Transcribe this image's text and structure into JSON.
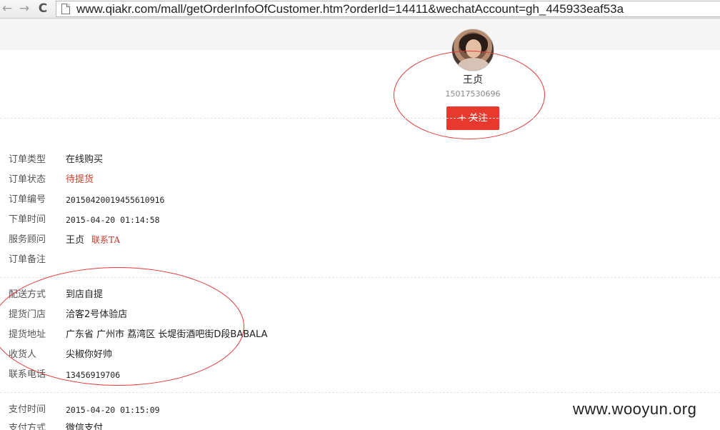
{
  "browser": {
    "back_icon": "←",
    "forward_icon": "→",
    "reload_icon": "C",
    "url": "www.qiakr.com/mall/getOrderInfoOfCustomer.htm?orderId=14411&wechatAccount=gh_445933eaf53a"
  },
  "profile": {
    "name": "王贞",
    "phone": "15017530696",
    "follow_label": "+ 关注"
  },
  "order": {
    "type_label": "订单类型",
    "type_value": "在线购买",
    "status_label": "订单状态",
    "status_value": "待提货",
    "number_label": "订单编号",
    "number_value": "20150420019455610916",
    "time_label": "下单时间",
    "time_value": "2015-04-20 01:14:58",
    "advisor_label": "服务顾问",
    "advisor_value": "王贞",
    "advisor_contact": "联系TA",
    "note_label": "订单备注"
  },
  "delivery": {
    "method_label": "配送方式",
    "method_value": "到店自提",
    "store_label": "提货门店",
    "store_value": "洽客2号体验店",
    "address_label": "提货地址",
    "address_value": "广东省 广州市 荔湾区 长堤街酒吧街D段BABALA",
    "receiver_label": "收货人",
    "receiver_value": "尖椒你好帅",
    "phone_label": "联系电话",
    "phone_value": "13456919706"
  },
  "payment": {
    "time_label": "支付时间",
    "time_value": "2015-04-20 01:15:09",
    "method_label": "支付方式",
    "method_value": "微信支付"
  },
  "watermark": "www.wooyun.org",
  "colors": {
    "accent": "#e8392f",
    "annotation": "#e03a3a",
    "status": "#d43a2b"
  }
}
